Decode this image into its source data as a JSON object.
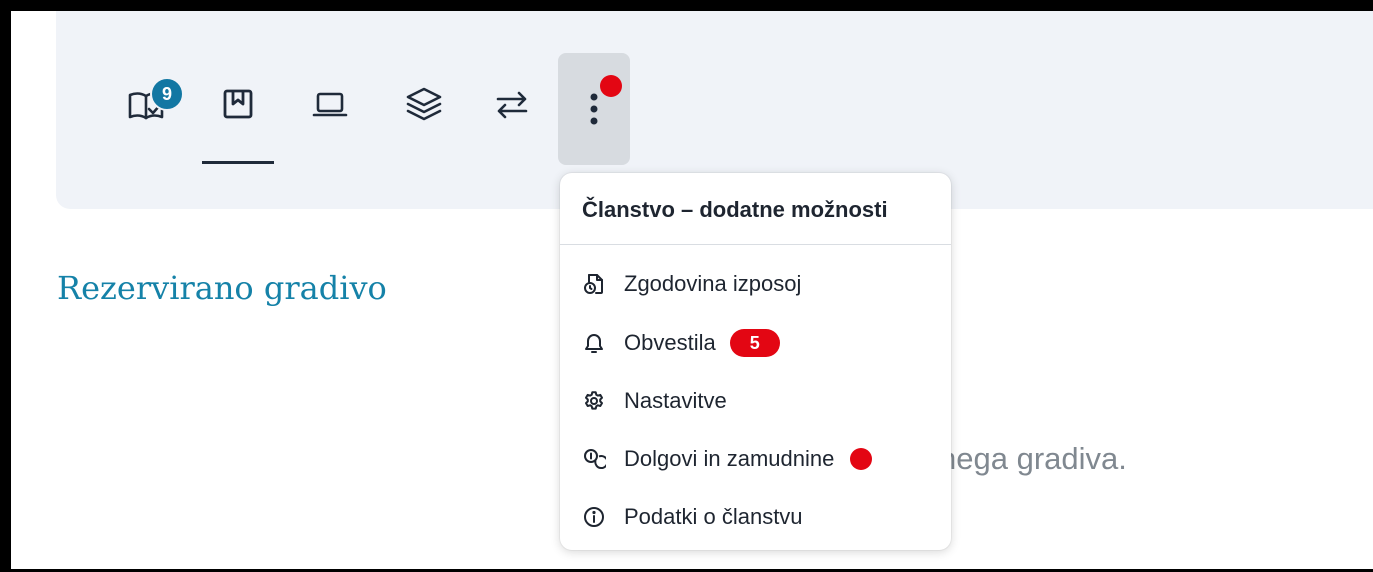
{
  "toolbar": {
    "tabs": [
      {
        "icon": "book-check-icon",
        "badge": "9"
      },
      {
        "icon": "bookmark-icon",
        "active": true
      },
      {
        "icon": "laptop-icon"
      },
      {
        "icon": "layers-icon"
      },
      {
        "icon": "transfer-arrows-icon"
      }
    ],
    "more_icon": "dots-vertical-icon"
  },
  "section": {
    "title": "Rezervirano gradivo",
    "empty_text_partial": "nega gradiva."
  },
  "menu": {
    "title": "Članstvo – dodatne možnosti",
    "items": [
      {
        "label": "Zgodovina izposoj",
        "icon": "history-document-icon"
      },
      {
        "label": "Obvestila",
        "icon": "bell-icon",
        "count": "5"
      },
      {
        "label": "Nastavitve",
        "icon": "gear-icon"
      },
      {
        "label": "Dolgovi in zamudnine",
        "icon": "coins-icon",
        "alert_dot": true
      },
      {
        "label": "Podatki o članstvu",
        "icon": "info-icon"
      }
    ]
  },
  "colors": {
    "accent": "#1582a8",
    "badge_blue": "#1277a3",
    "alert_red": "#e30613",
    "toolbar_bg": "#f0f3f8"
  }
}
